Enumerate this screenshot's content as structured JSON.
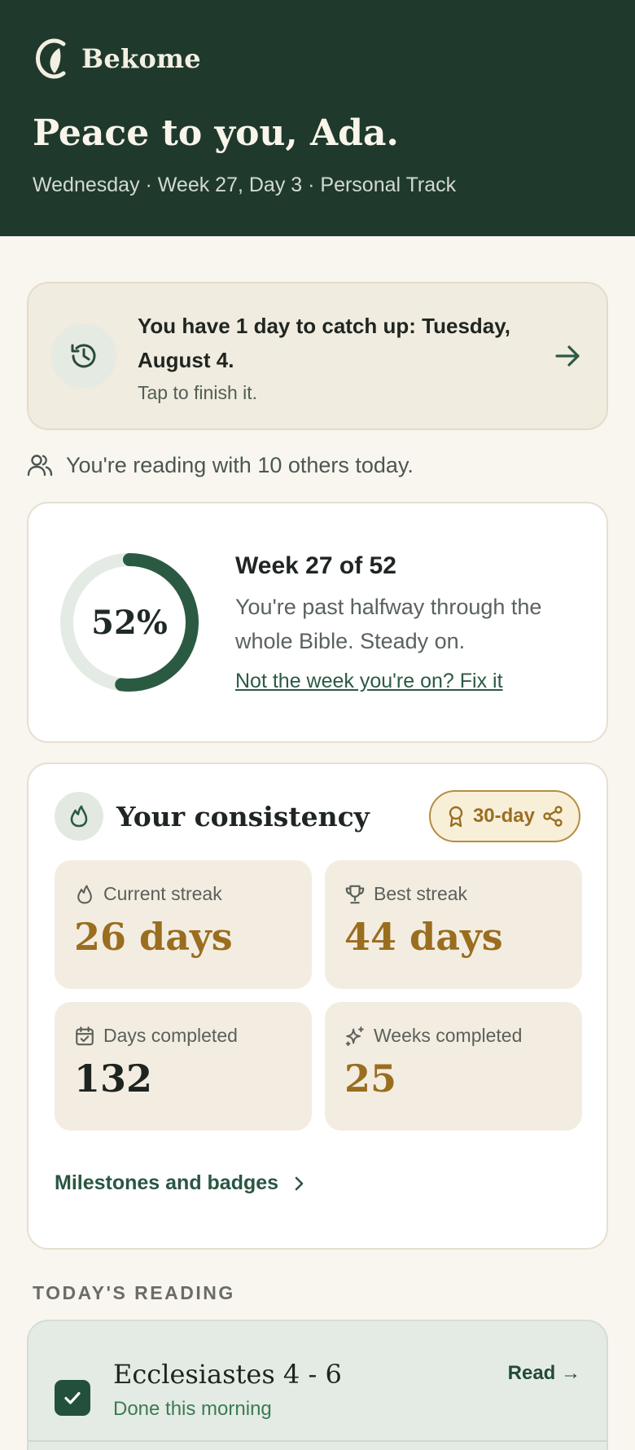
{
  "brand": {
    "name": "Bekome",
    "logo_icon": "leaf-c-logo"
  },
  "header": {
    "greeting": "Peace to you, Ada.",
    "subtitle": "Wednesday · Week 27, Day 3 · Personal Track"
  },
  "catchup": {
    "icon": "history-icon",
    "title": "You have 1 day to catch up: Tuesday, August 4.",
    "subtitle": "Tap to finish it."
  },
  "readers": {
    "text": "You're reading with 10 others today."
  },
  "progress": {
    "percent_label": "52%",
    "percent": 52,
    "title": "Week 27 of 52",
    "body": "You're past halfway through the whole Bible. Steady on.",
    "link": "Not the week you're on? Fix it"
  },
  "consistency": {
    "title": "Your consistency",
    "badge": "30-day",
    "stats": [
      {
        "label": "Current streak",
        "value": "26 days",
        "icon": "flame-icon"
      },
      {
        "label": "Best streak",
        "value": "44 days",
        "icon": "trophy-icon"
      },
      {
        "label": "Days completed",
        "value": "132",
        "icon": "calendar-check-icon"
      },
      {
        "label": "Weeks completed",
        "value": "25",
        "icon": "sparkle-icon"
      }
    ],
    "milestones_link": "Milestones and badges"
  },
  "today": {
    "section_label": "TODAY'S READING",
    "title": "Ecclesiastes 4 - 6",
    "status": "Done this morning",
    "read_link": "Read →"
  },
  "colors": {
    "header_bg": "#1f3a2c",
    "accent_green": "#2c5a45",
    "gold": "#9a6d1f",
    "page_bg": "#f9f6f0"
  }
}
